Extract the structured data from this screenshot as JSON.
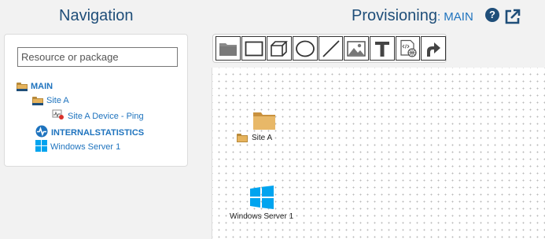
{
  "navigation": {
    "title": "Navigation",
    "search_placeholder": "Resource or package",
    "tree": [
      {
        "label": "MAIN",
        "icon": "folder-icon"
      },
      {
        "label": "Site A",
        "icon": "folder-icon"
      },
      {
        "label": "Site A Device - Ping",
        "icon": "ping-device-icon"
      },
      {
        "label": "INTERNALSTATISTICS",
        "icon": "pulse-icon"
      },
      {
        "label": "Windows Server 1",
        "icon": "windows-icon"
      }
    ]
  },
  "provisioning": {
    "title": "Provisioning",
    "separator": ": ",
    "context": "MAIN"
  },
  "toolbar": {
    "tools": [
      "folder-tool",
      "rectangle-tool",
      "cube-tool",
      "ellipse-tool",
      "line-tool",
      "image-tool",
      "text-tool",
      "web-widget-tool",
      "link-arrow-tool"
    ]
  },
  "canvas": {
    "nodes": [
      {
        "label": "Site A",
        "icon": "folder-icon"
      },
      {
        "label": "Windows Server 1",
        "icon": "windows-icon"
      }
    ]
  },
  "colors": {
    "heading": "#1f4e79",
    "link": "#1e73be",
    "folder": "#e6b35c",
    "windows": "#00a4ef"
  }
}
